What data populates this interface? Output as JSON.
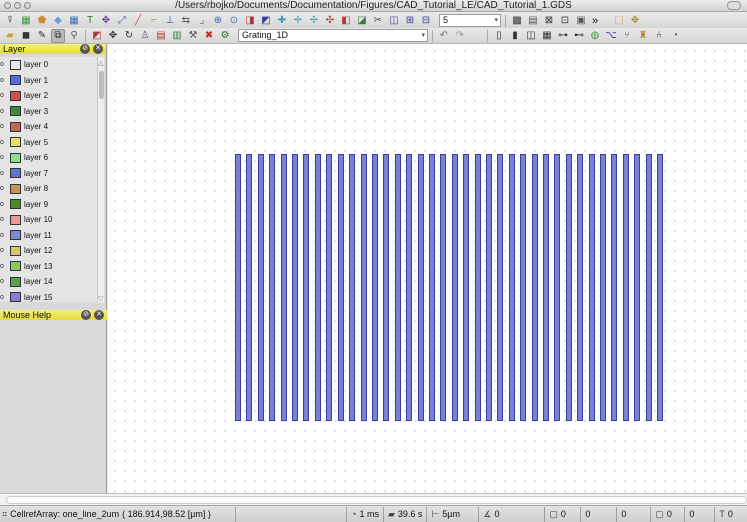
{
  "window": {
    "title": "/Users/rbojko/Documents/Documentation/Figures/CAD_Tutorial_LE/CAD_Tutorial_1.GDS"
  },
  "toolbar_row1": {
    "buttons": [
      {
        "name": "arrow-select-icon",
        "glyph": "⍒",
        "color": "#555"
      },
      {
        "name": "grid-icon",
        "glyph": "▦",
        "color": "#3a9a3a"
      },
      {
        "name": "polygon-icon",
        "glyph": "⬟",
        "color": "#d08a3a"
      },
      {
        "name": "shapes-icon",
        "glyph": "◆",
        "color": "#6a9ae0"
      },
      {
        "name": "array-icon",
        "glyph": "▦",
        "color": "#3a6ac0"
      },
      {
        "name": "text-tool-icon",
        "glyph": "T",
        "color": "#2a7a2a"
      },
      {
        "name": "move-icon",
        "glyph": "✥",
        "color": "#6a3aa0"
      },
      {
        "name": "scale-icon",
        "glyph": "⤢",
        "color": "#4a6ac0"
      },
      {
        "name": "path-icon",
        "glyph": "╱",
        "color": "#c05a3a"
      },
      {
        "name": "bend-icon",
        "glyph": "⌐",
        "color": "#b08a2a"
      },
      {
        "name": "align-icon",
        "glyph": "⊥",
        "color": "#3a5aa0"
      },
      {
        "name": "flip-icon",
        "glyph": "⇆",
        "color": "#5a5a5a"
      },
      {
        "name": "corner-icon",
        "glyph": "⌟",
        "color": "#7a5a2a"
      },
      {
        "name": "zoom-in-icon",
        "glyph": "⊕",
        "color": "#3a6ab0"
      },
      {
        "name": "zoom-fit-icon",
        "glyph": "⊙",
        "color": "#3a6ab0"
      },
      {
        "name": "cell-icon",
        "glyph": "◨",
        "color": "#a03a3a"
      },
      {
        "name": "select-cell-icon",
        "glyph": "◩",
        "color": "#3a3a9a"
      },
      {
        "name": "node-icon",
        "glyph": "✚",
        "color": "#3a9ab0"
      },
      {
        "name": "node-move-icon",
        "glyph": "✛",
        "color": "#3a9ab0"
      },
      {
        "name": "node-add-icon",
        "glyph": "✢",
        "color": "#3a9ab0"
      },
      {
        "name": "node-del-icon",
        "glyph": "✣",
        "color": "#b03a3a"
      },
      {
        "name": "boolean-icon",
        "glyph": "◧",
        "color": "#b03a3a"
      },
      {
        "name": "merge-icon",
        "glyph": "◪",
        "color": "#3a7a3a"
      },
      {
        "name": "cut-icon",
        "glyph": "✂",
        "color": "#555"
      },
      {
        "name": "split-icon",
        "glyph": "◫",
        "color": "#5a3a9a"
      },
      {
        "name": "measure-icon",
        "glyph": "⊞",
        "color": "#3a3a9a"
      },
      {
        "name": "ruler-icon",
        "glyph": "⊟",
        "color": "#3a3a9a"
      }
    ],
    "combo_value": "5",
    "right_buttons": [
      {
        "name": "grid-dense-icon",
        "glyph": "▩",
        "color": "#333"
      },
      {
        "name": "grid-sparse-icon",
        "glyph": "▤",
        "color": "#555"
      },
      {
        "name": "snap-icon",
        "glyph": "⊠",
        "color": "#333"
      },
      {
        "name": "snap-edge-icon",
        "glyph": "⊡",
        "color": "#333"
      },
      {
        "name": "snap-mid-icon",
        "glyph": "▣",
        "color": "#555"
      }
    ],
    "more_glyph": "»",
    "far_right": [
      {
        "name": "select-box-icon",
        "glyph": "⬚",
        "color": "#b08a2a"
      },
      {
        "name": "transform-icon",
        "glyph": "✥",
        "color": "#b08a2a"
      }
    ]
  },
  "toolbar_row2": {
    "buttons": [
      {
        "name": "open-icon",
        "glyph": "▰",
        "color": "#c9a32a"
      },
      {
        "name": "save-icon",
        "glyph": "◼",
        "color": "#333"
      },
      {
        "name": "edit-icon",
        "glyph": "✎",
        "color": "#333"
      },
      {
        "name": "zoom-box-icon",
        "glyph": "⧉",
        "color": "#333"
      },
      {
        "name": "pan-icon",
        "glyph": "⚲",
        "color": "#555"
      }
    ],
    "buttons2": [
      {
        "name": "copy-cell-icon",
        "glyph": "◩",
        "color": "#b03a3a"
      },
      {
        "name": "move-cross-icon",
        "glyph": "✥",
        "color": "#333"
      },
      {
        "name": "rotate-icon",
        "glyph": "↻",
        "color": "#333"
      },
      {
        "name": "person-icon",
        "glyph": "♙",
        "color": "#555"
      },
      {
        "name": "group-icon",
        "glyph": "▤",
        "color": "#b03a3a"
      },
      {
        "name": "ungroup-icon",
        "glyph": "▥",
        "color": "#3a7a3a"
      },
      {
        "name": "hammer-icon",
        "glyph": "⚒",
        "color": "#555"
      },
      {
        "name": "delete-icon",
        "glyph": "✖",
        "color": "#c02a2a"
      },
      {
        "name": "cell-pattern-icon",
        "glyph": "⚙",
        "color": "#3a6a3a"
      }
    ],
    "cell_combo": "Grating_1D",
    "buttons3": [
      {
        "name": "undo-icon",
        "glyph": "↶",
        "color": "#777"
      },
      {
        "name": "redo-icon",
        "glyph": "↷",
        "color": "#999"
      }
    ],
    "buttons4": [
      {
        "name": "page-icon",
        "glyph": "▯",
        "color": "#333"
      },
      {
        "name": "doc-icon",
        "glyph": "▮",
        "color": "#333"
      },
      {
        "name": "layout-icon",
        "glyph": "◫",
        "color": "#333"
      },
      {
        "name": "stack-icon",
        "glyph": "▦",
        "color": "#333"
      },
      {
        "name": "hierarchy-icon",
        "glyph": "⊶",
        "color": "#333"
      },
      {
        "name": "graph-icon",
        "glyph": "⊷",
        "color": "#333"
      },
      {
        "name": "circle-graph-icon",
        "glyph": "◍",
        "color": "#3a9a3a"
      },
      {
        "name": "tree-icon",
        "glyph": "⌥",
        "color": "#3a3a9a"
      },
      {
        "name": "fork-icon",
        "glyph": "⑂",
        "color": "#3a7a3a"
      },
      {
        "name": "walk-icon",
        "glyph": "♜",
        "color": "#b08a2a"
      },
      {
        "name": "branch-icon",
        "glyph": "⑃",
        "color": "#333"
      },
      {
        "name": "clock-icon",
        "glyph": "◔",
        "color": "#555"
      }
    ]
  },
  "layer_panel": {
    "title": "Layer",
    "layers": [
      {
        "label": "layer 0",
        "color": "#efe6e2",
        "mark": "o"
      },
      {
        "label": "layer 1",
        "color": "#5a6ad8",
        "mark": "o"
      },
      {
        "label": "layer 2",
        "color": "#d84a4a",
        "mark": "o"
      },
      {
        "label": "layer 3",
        "color": "#3a8a3a",
        "mark": "o"
      },
      {
        "label": "layer 4",
        "color": "#c46a4a",
        "mark": "o"
      },
      {
        "label": "layer 5",
        "color": "#e8e05a",
        "mark": "o"
      },
      {
        "label": "layer 6",
        "color": "#8ae08a",
        "mark": "o"
      },
      {
        "label": "layer 7",
        "color": "#5a7ac8",
        "mark": "o"
      },
      {
        "label": "layer 8",
        "color": "#c8905a",
        "mark": "o"
      },
      {
        "label": "layer 9",
        "color": "#4a8a2a",
        "mark": "o"
      },
      {
        "label": "layer 10",
        "color": "#e89a9a",
        "mark": "o"
      },
      {
        "label": "layer 11",
        "color": "#7a8ad8",
        "mark": "o"
      },
      {
        "label": "layer 12",
        "color": "#d8c86a",
        "mark": "o"
      },
      {
        "label": "layer 13",
        "color": "#8ac85a",
        "mark": "o"
      },
      {
        "label": "layer 14",
        "color": "#5aa04a",
        "mark": "o"
      },
      {
        "label": "layer 15",
        "color": "#8a7ad8",
        "mark": "o"
      }
    ]
  },
  "mouse_help_panel": {
    "title": "Mouse Help"
  },
  "canvas": {
    "grating": {
      "bar_count": 38,
      "bar_color": "#7a80d4",
      "outline_color": "#3a3f9e"
    }
  },
  "status_bar": {
    "left_text": "CellrefArray: one_line_2um",
    "coords": "( 186.914,98.52 [µm] )",
    "time": "1 ms",
    "duration": "39.6 s",
    "grid": "5µm",
    "angle": "0",
    "v1": "0",
    "v2": "0",
    "v3": "0",
    "v4": "0",
    "v5": "0",
    "t": "0"
  }
}
